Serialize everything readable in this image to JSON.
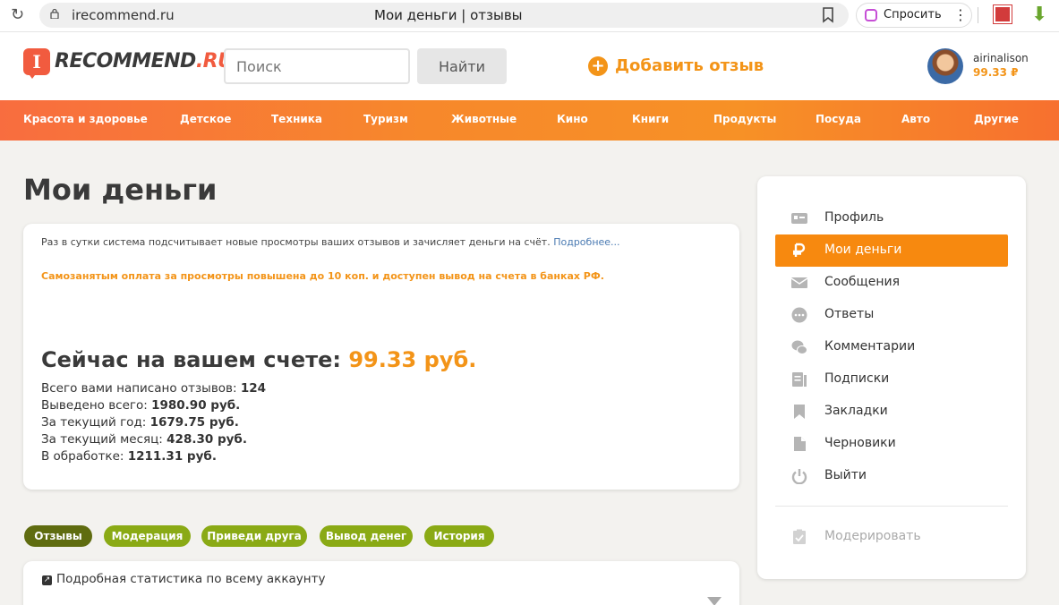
{
  "browser": {
    "url": "irecommend.ru",
    "tab_title": "Мои деньги | отзывы",
    "ask_label": "Спросить"
  },
  "header": {
    "logo_prefix": "RECOMMEND",
    "logo_suffix": ".RU",
    "logo_letter": "I",
    "search_placeholder": "Поиск",
    "search_button": "Найти",
    "add_review": "Добавить отзыв",
    "username": "airinalison",
    "balance": "99.33 ₽"
  },
  "categories": [
    "Красота и здоровье",
    "Детское",
    "Техника",
    "Туризм",
    "Животные",
    "Кино",
    "Книги",
    "Продукты",
    "Посуда",
    "Авто",
    "Другие"
  ],
  "main": {
    "title": "Мои деньги",
    "info_text": "Раз в сутки система подсчитывает новые просмотры ваших отзывов и зачисляет деньги на счёт.",
    "more_link": "Подробнее...",
    "promo": "Самозанятым оплата за просмотры повышена до 10 коп. и доступен вывод на счета в банках РФ.",
    "now_label": "Сейчас на вашем счете:",
    "now_amount": "99.33 руб.",
    "stats": [
      {
        "label": "Всего вами написано отзывов:",
        "value": "124"
      },
      {
        "label": "Выведено всего:",
        "value": "1980.90 руб."
      },
      {
        "label": "За текущий год:",
        "value": "1679.75 руб."
      },
      {
        "label": "За текущий месяц:",
        "value": "428.30 руб."
      },
      {
        "label": "В обработке:",
        "value": "1211.31 руб."
      }
    ],
    "tabs": [
      "Отзывы",
      "Модерация",
      "Приведи друга",
      "Вывод денег",
      "История"
    ],
    "stats_link": "Подробная статистика по всему аккаунту"
  },
  "sidebar": {
    "items": [
      {
        "label": "Профиль",
        "icon": "profile-card-icon"
      },
      {
        "label": "Мои деньги",
        "icon": "ruble-icon"
      },
      {
        "label": "Сообщения",
        "icon": "envelope-icon"
      },
      {
        "label": "Ответы",
        "icon": "chat-bubble-icon"
      },
      {
        "label": "Комментарии",
        "icon": "comments-icon"
      },
      {
        "label": "Подписки",
        "icon": "subscriptions-icon"
      },
      {
        "label": "Закладки",
        "icon": "bookmark-icon"
      },
      {
        "label": "Черновики",
        "icon": "draft-icon"
      },
      {
        "label": "Выйти",
        "icon": "power-icon"
      }
    ],
    "moderate": {
      "label": "Модерировать",
      "icon": "clipboard-check-icon"
    }
  },
  "colors": {
    "accent_orange": "#f39418",
    "brand_red": "#f15b3f",
    "tab_green": "#8aaa15",
    "tab_green_active": "#5f6c10",
    "link_blue": "#4a7ab2"
  }
}
